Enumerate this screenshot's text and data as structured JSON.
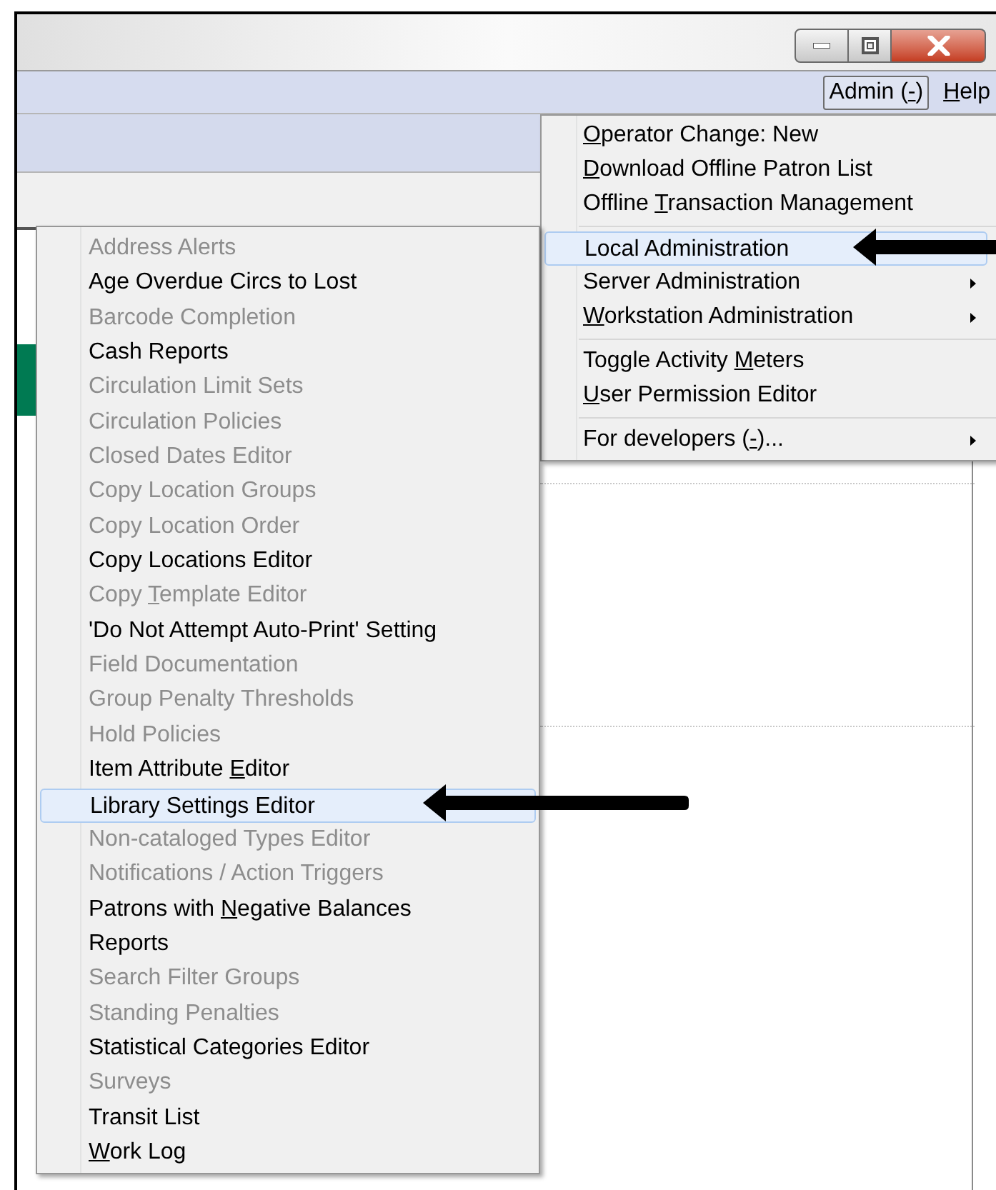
{
  "window": {
    "controls": [
      {
        "kind": "minimize"
      },
      {
        "kind": "restore"
      },
      {
        "kind": "close"
      }
    ]
  },
  "menubar": {
    "items": [
      {
        "label_before": "Admin (",
        "access_key": "-",
        "label_after": ")",
        "selected": true
      },
      {
        "access_key": "H",
        "label_after": "elp",
        "selected": false
      }
    ]
  },
  "admin_menu": {
    "groups": [
      [
        {
          "access_key": "O",
          "label_after": "perator Change: New",
          "disabled": false,
          "selected": false,
          "has_submenu": false
        },
        {
          "access_key": "D",
          "label_after": "ownload Offline Patron List",
          "disabled": false,
          "selected": false,
          "has_submenu": false
        },
        {
          "label_before": "Offline ",
          "access_key": "T",
          "label_after": "ransaction Management",
          "disabled": false,
          "selected": false,
          "has_submenu": false
        }
      ],
      [
        {
          "label": "Local Administration",
          "disabled": false,
          "selected": true,
          "has_submenu": false
        },
        {
          "label": "Server Administration",
          "disabled": false,
          "selected": false,
          "has_submenu": true
        },
        {
          "access_key": "W",
          "label_after": "orkstation Administration",
          "disabled": false,
          "selected": false,
          "has_submenu": true
        }
      ],
      [
        {
          "label_before": "Toggle Activity ",
          "access_key": "M",
          "label_after": "eters",
          "disabled": false,
          "selected": false,
          "has_submenu": false
        },
        {
          "access_key": "U",
          "label_after": "ser Permission Editor",
          "disabled": false,
          "selected": false,
          "has_submenu": false
        }
      ],
      [
        {
          "label_before": "For developers (",
          "access_key": "-",
          "label_after": ")...",
          "disabled": false,
          "selected": false,
          "has_submenu": true
        }
      ]
    ]
  },
  "local_administration_menu": {
    "items": [
      {
        "label": "Address Alerts",
        "disabled": true,
        "selected": false
      },
      {
        "label": "Age Overdue Circs to Lost",
        "disabled": false,
        "selected": false
      },
      {
        "label": "Barcode Completion",
        "disabled": true,
        "selected": false
      },
      {
        "label": "Cash Reports",
        "disabled": false,
        "selected": false
      },
      {
        "label": "Circulation Limit Sets",
        "disabled": true,
        "selected": false
      },
      {
        "label": "Circulation Policies",
        "disabled": true,
        "selected": false
      },
      {
        "label": "Closed Dates Editor",
        "disabled": true,
        "selected": false
      },
      {
        "label": "Copy Location Groups",
        "disabled": true,
        "selected": false
      },
      {
        "label": "Copy Location Order",
        "disabled": true,
        "selected": false
      },
      {
        "label": "Copy Locations Editor",
        "disabled": false,
        "selected": false
      },
      {
        "label_before": "Copy ",
        "access_key": "T",
        "label_after": "emplate Editor",
        "disabled": true,
        "selected": false
      },
      {
        "label": "'Do Not Attempt Auto-Print' Setting",
        "disabled": false,
        "selected": false
      },
      {
        "label": "Field Documentation",
        "disabled": true,
        "selected": false
      },
      {
        "label": "Group Penalty Thresholds",
        "disabled": true,
        "selected": false
      },
      {
        "label": "Hold Policies",
        "disabled": true,
        "selected": false
      },
      {
        "label_before": "Item Attribute ",
        "access_key": "E",
        "label_after": "ditor",
        "disabled": false,
        "selected": false
      },
      {
        "label": "Library Settings Editor",
        "disabled": false,
        "selected": true
      },
      {
        "label": "Non-cataloged Types Editor",
        "disabled": true,
        "selected": false
      },
      {
        "label": "Notifications / Action Triggers",
        "disabled": true,
        "selected": false
      },
      {
        "label_before": "Patrons with ",
        "access_key": "N",
        "label_after": "egative Balances",
        "disabled": false,
        "selected": false
      },
      {
        "label": "Reports",
        "disabled": false,
        "selected": false
      },
      {
        "label": "Search Filter Groups",
        "disabled": true,
        "selected": false
      },
      {
        "label": "Standing Penalties",
        "disabled": true,
        "selected": false
      },
      {
        "label": "Statistical Categories Editor",
        "disabled": false,
        "selected": false
      },
      {
        "label": "Surveys",
        "disabled": true,
        "selected": false
      },
      {
        "label": "Transit List",
        "disabled": false,
        "selected": false
      },
      {
        "access_key": "W",
        "label_after": "ork Log",
        "disabled": false,
        "selected": false
      }
    ]
  }
}
